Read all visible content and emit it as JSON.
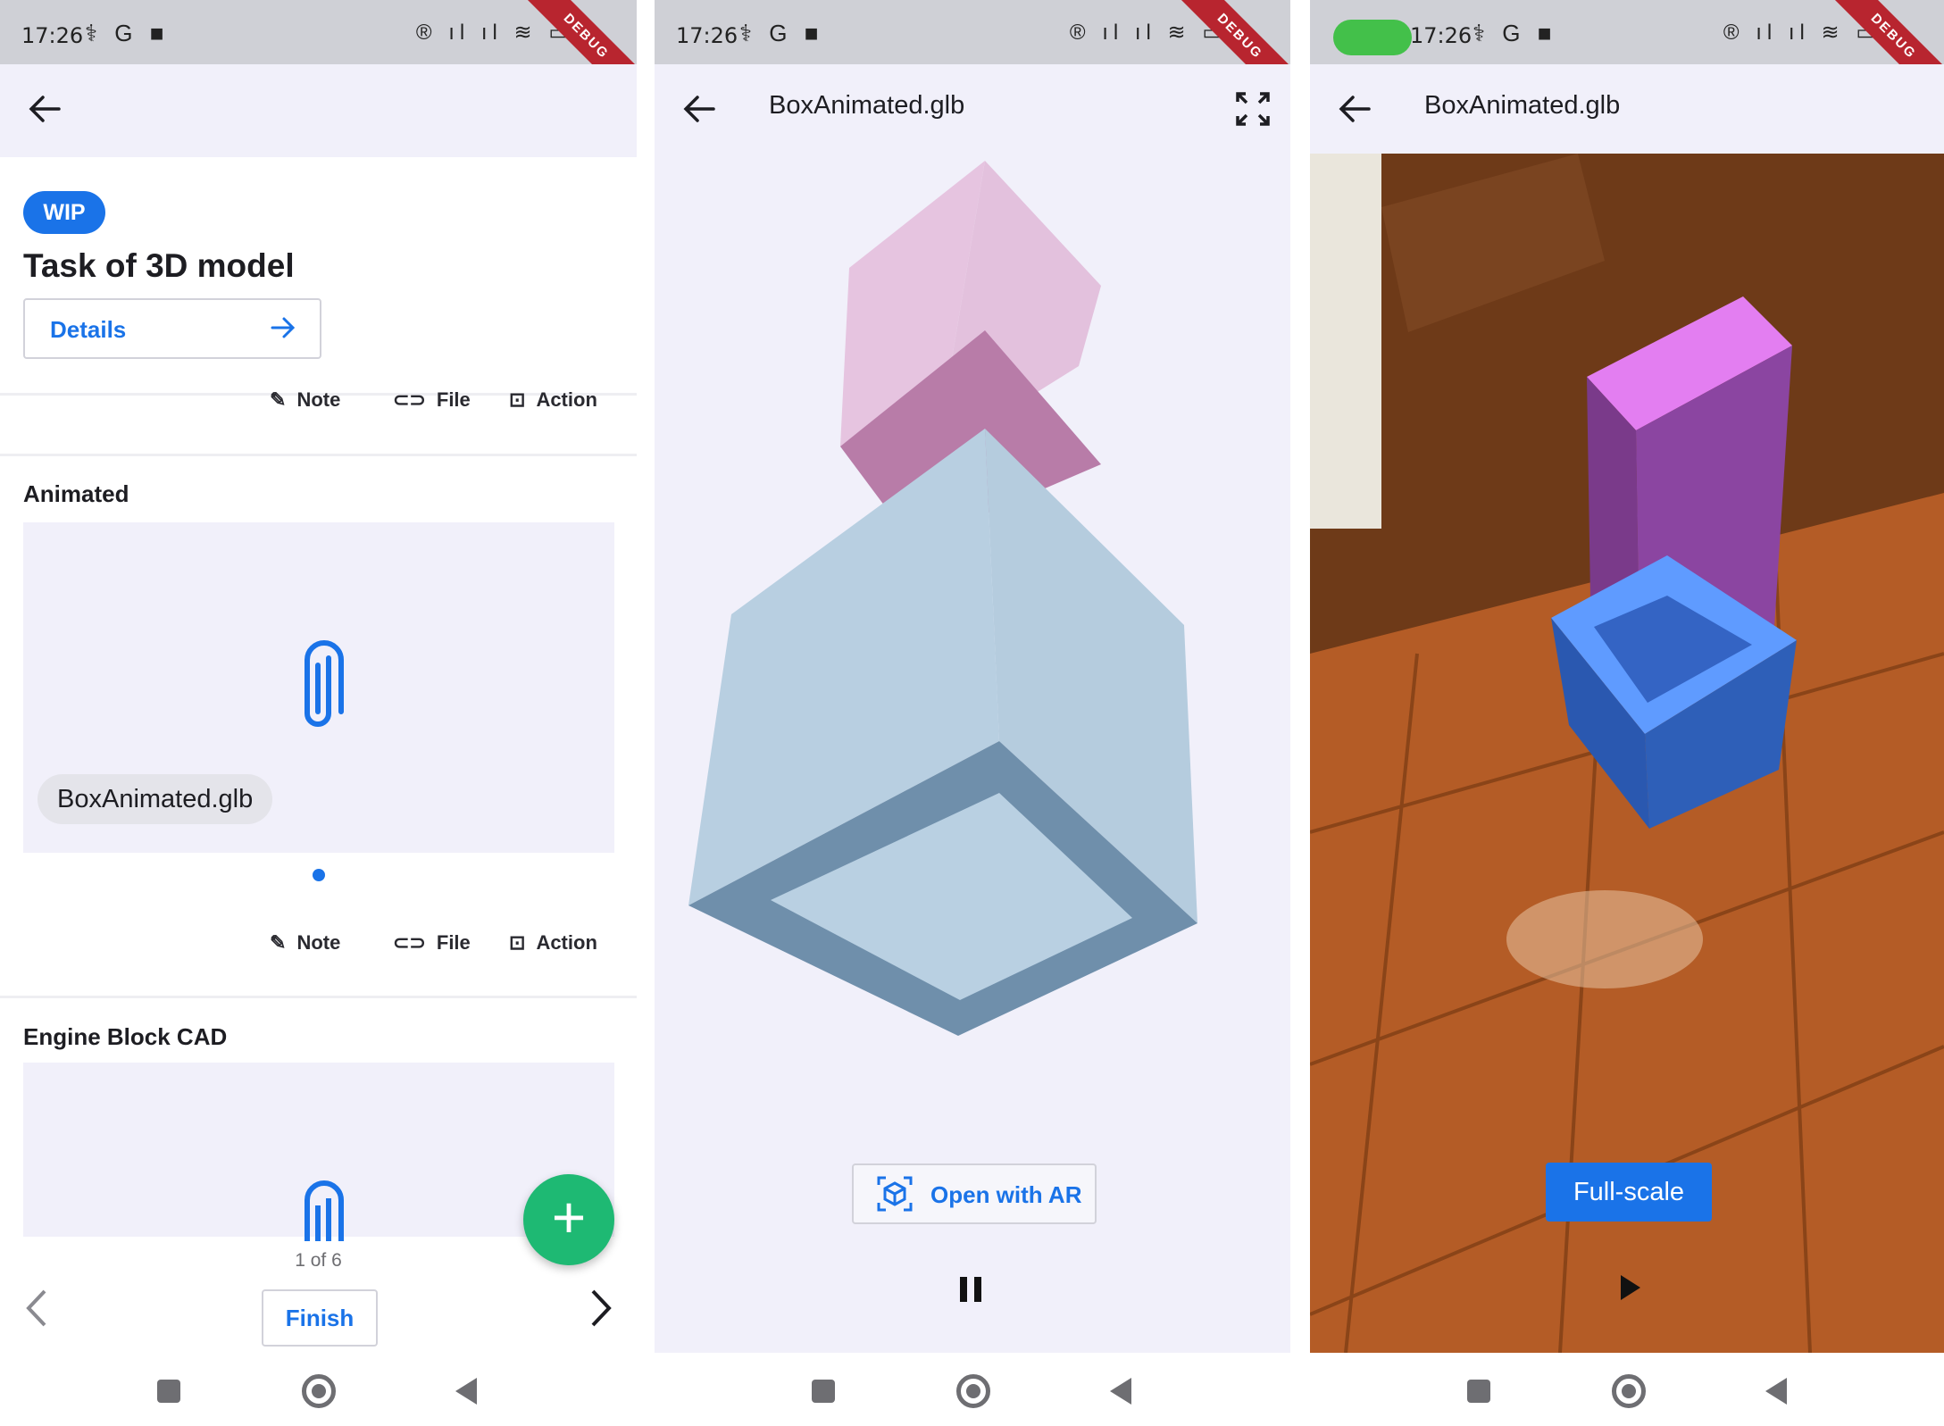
{
  "status": {
    "time": "17:26",
    "left_icons": "⚕ G ■",
    "right_icons": "® ıl ıl ≋ ▭",
    "debug_label": "DEBUG"
  },
  "task": {
    "badge": "WIP",
    "title": "Task of 3D model",
    "details_label": "Details",
    "actions": {
      "note": "Note",
      "file": "File",
      "action": "Action"
    },
    "sections": [
      {
        "title": "Animated",
        "attachment": "BoxAnimated.glb"
      },
      {
        "title": "Engine Block CAD"
      }
    ],
    "pager": "1 of 6",
    "finish_label": "Finish",
    "fab_label": "+"
  },
  "viewer": {
    "title": "BoxAnimated.glb",
    "ar_button": "Open with AR"
  },
  "ar": {
    "title": "BoxAnimated.glb",
    "full_scale_button": "Full-scale"
  },
  "colors": {
    "accent": "#1a73e8",
    "fab": "#1eb973",
    "debug": "#b8252f",
    "floor": "#b35a24"
  }
}
